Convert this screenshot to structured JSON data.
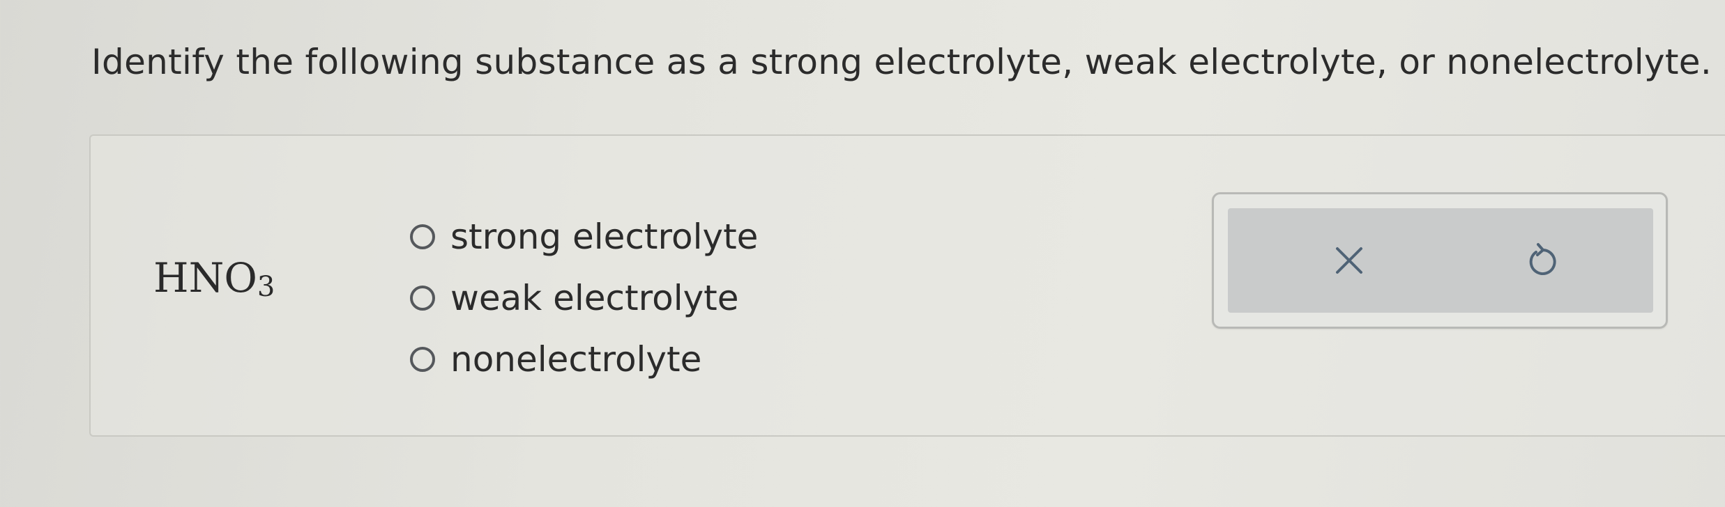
{
  "question": {
    "text": "Identify the following substance as a strong electrolyte, weak electrolyte, or nonelectrolyte."
  },
  "substance": {
    "formula_main": "HNO",
    "formula_subscript": "3"
  },
  "options": [
    {
      "label": "strong electrolyte",
      "selected": false
    },
    {
      "label": "weak electrolyte",
      "selected": false
    },
    {
      "label": "nonelectrolyte",
      "selected": false
    }
  ],
  "toolbar": {
    "clear_icon": "x-icon",
    "reset_icon": "undo-icon",
    "icon_color": "#4f6376"
  }
}
